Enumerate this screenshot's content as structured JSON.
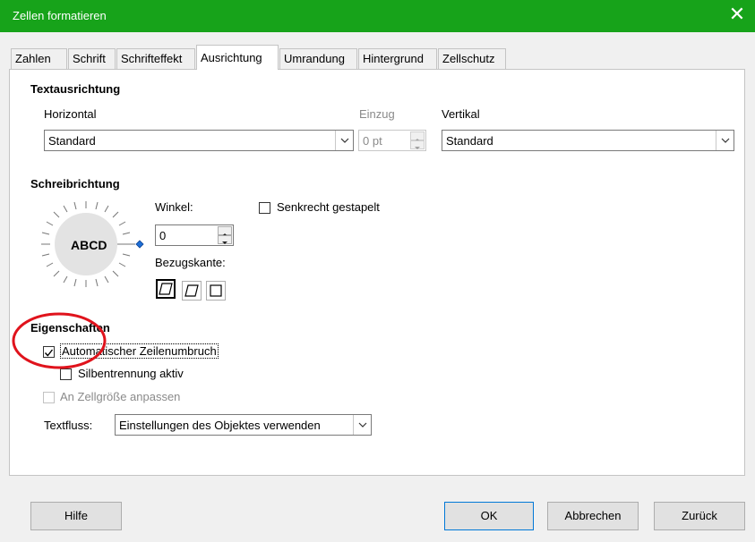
{
  "window": {
    "title": "Zellen formatieren",
    "close_glyph": "✕"
  },
  "tabs": [
    {
      "label": "Zahlen"
    },
    {
      "label": "Schrift"
    },
    {
      "label": "Schrifteffekt"
    },
    {
      "label": "Ausrichtung",
      "active": true
    },
    {
      "label": "Umrandung"
    },
    {
      "label": "Hintergrund"
    },
    {
      "label": "Zellschutz"
    }
  ],
  "text_alignment": {
    "title": "Textausrichtung",
    "horizontal_label": "Horizontal",
    "horizontal_value": "Standard",
    "indent_label": "Einzug",
    "indent_value": "0 pt",
    "vertical_label": "Vertikal",
    "vertical_value": "Standard"
  },
  "text_orientation": {
    "title": "Schreibrichtung",
    "dial_text": "ABCD",
    "angle_label": "Winkel:",
    "angle_value": "0",
    "reference_edge_label": "Bezugskante:",
    "vertically_stacked_label": "Senkrecht gestapelt",
    "vertically_stacked_checked": false
  },
  "properties": {
    "title": "Eigenschaften",
    "wrap_label": "Automatischer Zeilenumbruch",
    "wrap_checked": true,
    "hyphenation_label": "Silbentrennung aktiv",
    "hyphenation_checked": false,
    "shrink_label": "An Zellgröße anpassen",
    "shrink_checked": false,
    "text_flow_label": "Textfluss:",
    "text_flow_value": "Einstellungen des Objektes verwenden"
  },
  "buttons": {
    "help": "Hilfe",
    "ok": "OK",
    "cancel": "Abbrechen",
    "reset": "Zurück"
  },
  "colors": {
    "titlebar": "#17a31a",
    "annotation": "#e0131c",
    "dial_marker": "#1e6fd6"
  }
}
